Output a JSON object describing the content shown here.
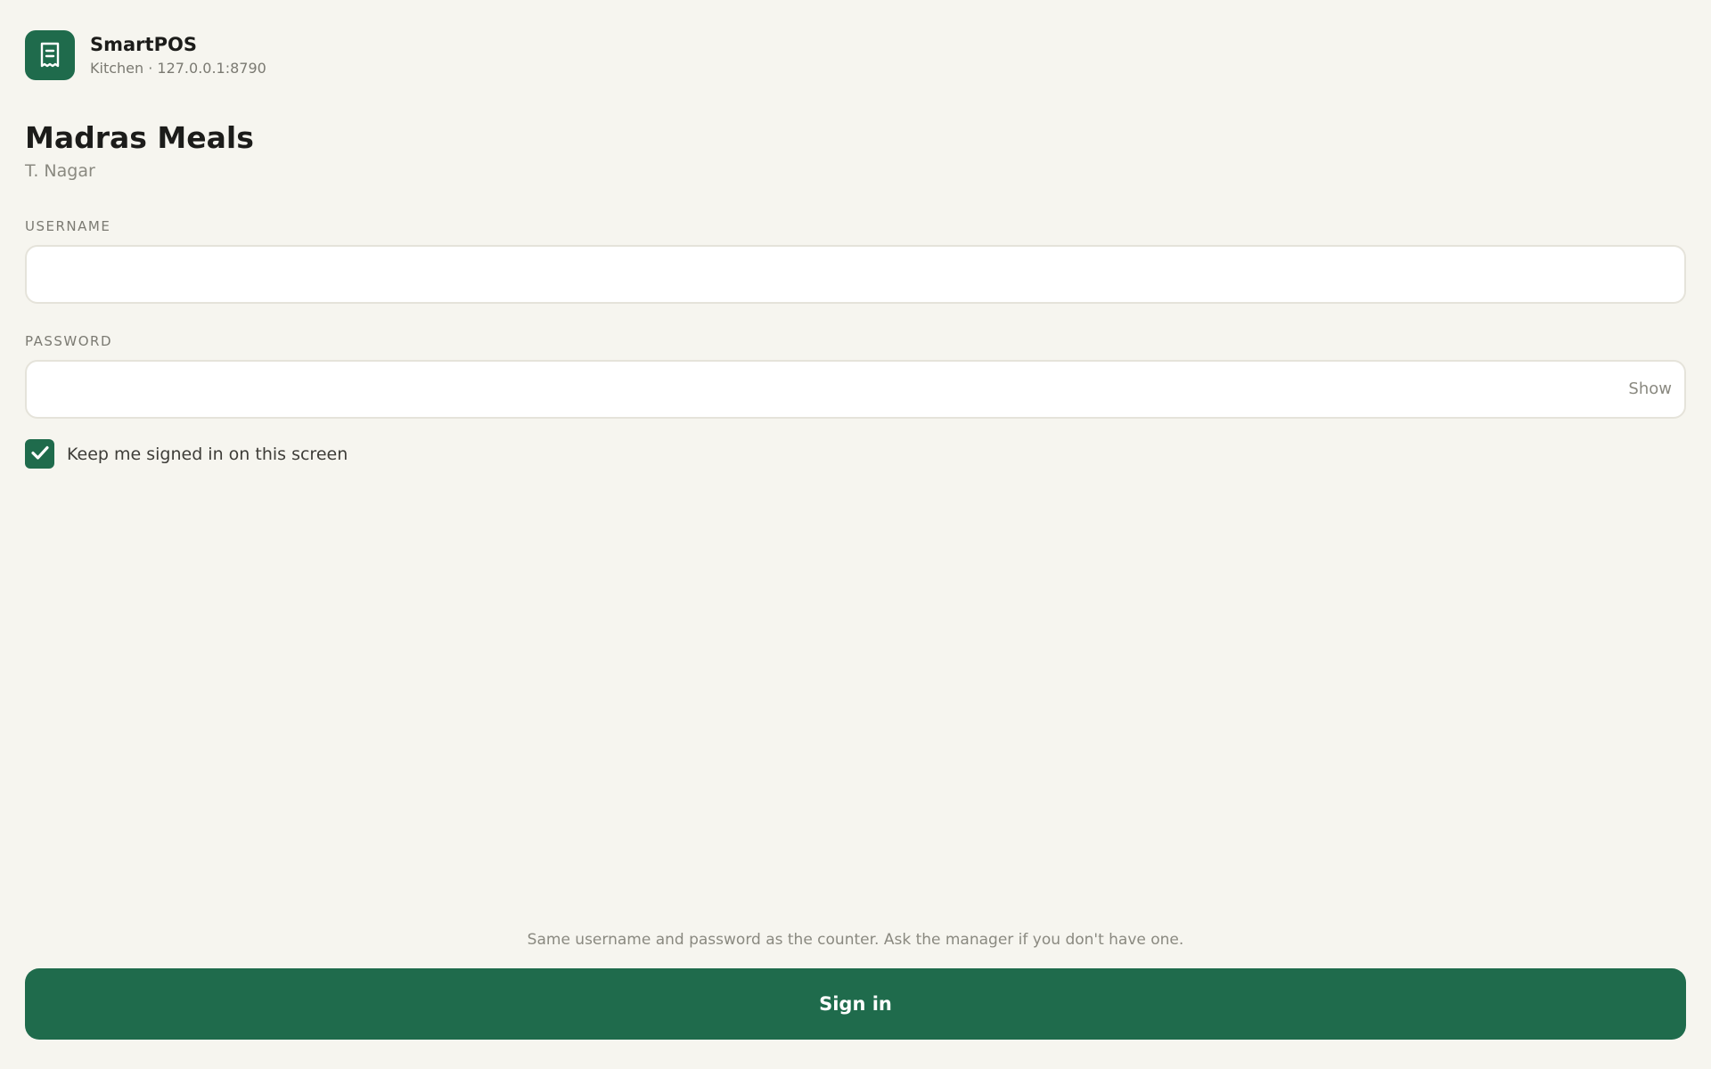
{
  "app": {
    "name": "SmartPOS",
    "subtitle": "Kitchen · 127.0.0.1:8790",
    "logo_icon": "receipt-icon"
  },
  "store": {
    "name": "Madras Meals",
    "location": "T. Nagar"
  },
  "form": {
    "username": {
      "label": "USERNAME",
      "value": "",
      "placeholder": ""
    },
    "password": {
      "label": "PASSWORD",
      "value": "",
      "placeholder": "",
      "toggle_label": "Show"
    },
    "keep_signed_in": {
      "label": "Keep me signed in on this screen",
      "checked": true,
      "icon": "check-icon"
    }
  },
  "footer": {
    "help_text": "Same username and password as the counter. Ask the manager if you don't have one.",
    "signin_label": "Sign in"
  },
  "colors": {
    "brand": "#1f6b4c",
    "background": "#f6f5ef"
  }
}
